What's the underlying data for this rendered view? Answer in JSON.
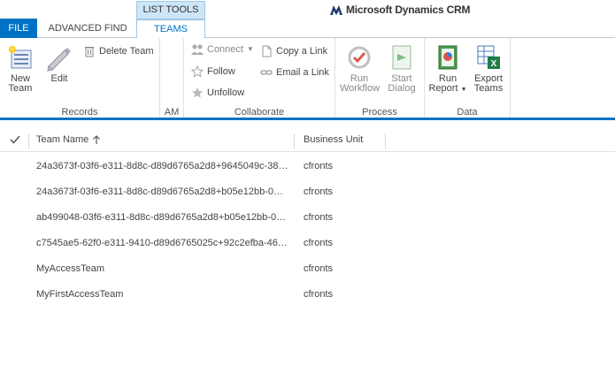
{
  "tabs": {
    "file": "FILE",
    "advanced_find": "ADVANCED FIND",
    "context_header": "LIST TOOLS",
    "teams": "TEAMS"
  },
  "brand": {
    "name": "Microsoft Dynamics CRM"
  },
  "ribbon": {
    "records": {
      "label": "Records",
      "new_team": [
        "New",
        "Team"
      ],
      "edit": "Edit",
      "delete_team": "Delete Team"
    },
    "am": {
      "label": "AM"
    },
    "collaborate": {
      "label": "Collaborate",
      "connect": "Connect",
      "follow": "Follow",
      "unfollow": "Unfollow",
      "copy_link": "Copy a Link",
      "email_link": "Email a Link"
    },
    "process": {
      "label": "Process",
      "run_workflow": [
        "Run",
        "Workflow"
      ],
      "start_dialog": [
        "Start",
        "Dialog"
      ]
    },
    "data": {
      "label": "Data",
      "run_report": [
        "Run",
        "Report"
      ],
      "export_teams": [
        "Export",
        "Teams"
      ]
    }
  },
  "grid": {
    "columns": {
      "team_name": "Team Name",
      "business_unit": "Business Unit"
    },
    "rows": [
      {
        "name": "24a3673f-03f6-e311-8d8c-d89d6765a2d8+9645049c-38f...",
        "bu": "cfronts"
      },
      {
        "name": "24a3673f-03f6-e311-8d8c-d89d6765a2d8+b05e12bb-03f...",
        "bu": "cfronts"
      },
      {
        "name": "ab499048-03f6-e311-8d8c-d89d6765a2d8+b05e12bb-03...",
        "bu": "cfronts"
      },
      {
        "name": "c7545ae5-62f0-e311-9410-d89d6765025c+92c2efba-46f5...",
        "bu": "cfronts"
      },
      {
        "name": "MyAccessTeam",
        "bu": "cfronts"
      },
      {
        "name": "MyFirstAccessTeam",
        "bu": "cfronts"
      }
    ]
  },
  "colors": {
    "accent": "#0072c6",
    "context_tab": "#cde6f7"
  },
  "icons": {
    "new_team": "new-team-icon",
    "edit": "edit-icon",
    "delete": "trash-icon",
    "connect": "connect-icon",
    "follow": "star-icon",
    "unfollow": "star-icon",
    "copy_link": "document-icon",
    "email_link": "link-icon",
    "run_workflow": "workflow-icon",
    "start_dialog": "dialog-icon",
    "run_report": "report-icon",
    "export": "excel-icon"
  }
}
